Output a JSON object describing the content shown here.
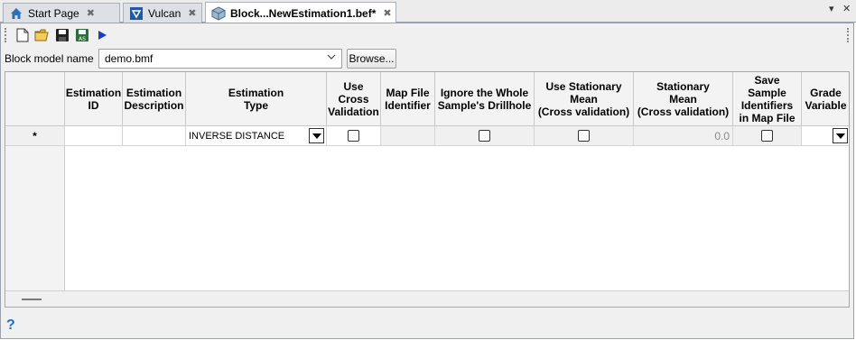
{
  "tabs": [
    {
      "label": "Start Page",
      "icon": "home-icon",
      "active": false
    },
    {
      "label": "Vulcan",
      "icon": "vulcan-icon",
      "active": false
    },
    {
      "label": "Block...NewEstimation1.bef*",
      "icon": "block-model-icon",
      "active": true
    }
  ],
  "window_controls": {
    "dropdown": "▾",
    "close": "✕"
  },
  "toolbar": {
    "buttons": [
      "new-file-icon",
      "open-folder-icon",
      "save-icon",
      "save-as-icon",
      "run-icon"
    ]
  },
  "block_model": {
    "label": "Block model name",
    "value": "demo.bmf",
    "browse_label": "Browse..."
  },
  "grid": {
    "columns": [
      "",
      "Estimation\nID",
      "Estimation\nDescription",
      "Estimation\nType",
      "Use Cross\nValidation",
      "Map File\nIdentifier",
      "Ignore the Whole\nSample's Drillhole",
      "Use Stationary\nMean\n(Cross validation)",
      "Stationary\nMean\n(Cross validation)",
      "Save Sample\nIdentifiers\nin Map File",
      "Grade\nVariable"
    ],
    "new_row": {
      "marker": "*",
      "estimation_id": "",
      "estimation_description": "",
      "estimation_type": "INVERSE DISTANCE",
      "use_cross_validation": false,
      "map_file_identifier": "",
      "ignore_whole_drillhole": false,
      "use_stationary_mean": false,
      "stationary_mean": "0.0",
      "save_sample_identifiers": false,
      "grade_variable": ""
    }
  },
  "help": {
    "label": "?"
  },
  "colors": {
    "accent": "#1b6fd1",
    "header_bg": "#f3f3f3",
    "panel_bg": "#f0f0f0"
  }
}
